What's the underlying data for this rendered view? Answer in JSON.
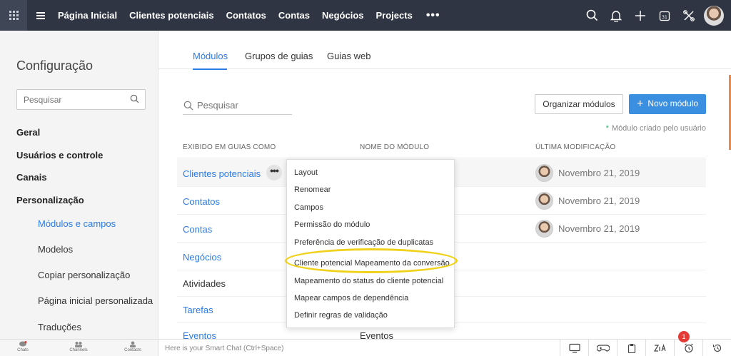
{
  "topbar": {
    "nav": [
      "Página Inicial",
      "Clientes potenciais",
      "Contatos",
      "Contas",
      "Negócios",
      "Projects"
    ],
    "more": "•••",
    "icons": [
      "search-icon",
      "bell-icon",
      "plus-icon",
      "calendar-icon",
      "tools-icon",
      "avatar"
    ]
  },
  "sidebar": {
    "title": "Configuração",
    "search_placeholder": "Pesquisar",
    "sections": [
      "Geral",
      "Usuários e controle",
      "Canais",
      "Personalização"
    ],
    "sub_items": [
      "Módulos e campos",
      "Modelos",
      "Copiar personalização",
      "Página inicial personalizada",
      "Traduções"
    ]
  },
  "tabs": [
    "Módulos",
    "Grupos de guias",
    "Guias web"
  ],
  "toolbar": {
    "search_placeholder": "Pesquisar",
    "organize_label": "Organizar módulos",
    "new_label": "Novo módulo",
    "note": "Módulo criado pelo usuário"
  },
  "table": {
    "headers": [
      "EXIBIDO EM GUIAS COMO",
      "NOME DO MÓDULO",
      "ÚLTIMA MODIFICAÇÃO"
    ],
    "rows": [
      {
        "name": "Clientes potenciais",
        "module": "",
        "modified": "Novembro 21, 2019"
      },
      {
        "name": "Contatos",
        "module": "",
        "modified": "Novembro 21, 2019"
      },
      {
        "name": "Contas",
        "module": "",
        "modified": "Novembro 21, 2019"
      },
      {
        "name": "Negócios",
        "module": "",
        "modified": ""
      },
      {
        "name": "Atividades",
        "module": "",
        "modified": ""
      },
      {
        "name": "Tarefas",
        "module": "",
        "modified": ""
      },
      {
        "name": "Eventos",
        "module": "Eventos",
        "modified": ""
      }
    ]
  },
  "menu": {
    "items": [
      "Layout",
      "Renomear",
      "Campos",
      "Permissão do módulo",
      "Preferência de verificação de duplicatas",
      "Cliente potencial Mapeamento da conversão",
      "Mapeamento do status do cliente potencial",
      "Mapear campos de dependência",
      "Definir regras de validação"
    ]
  },
  "bottombar": {
    "tabs": [
      "Chats",
      "Channels",
      "Contacts"
    ],
    "chat_hint": "Here is your Smart Chat (Ctrl+Space)",
    "badge": "1"
  },
  "colors": {
    "accent": "#2c7be5",
    "topbar": "#2f3542",
    "highlight": "#f0d21c"
  }
}
